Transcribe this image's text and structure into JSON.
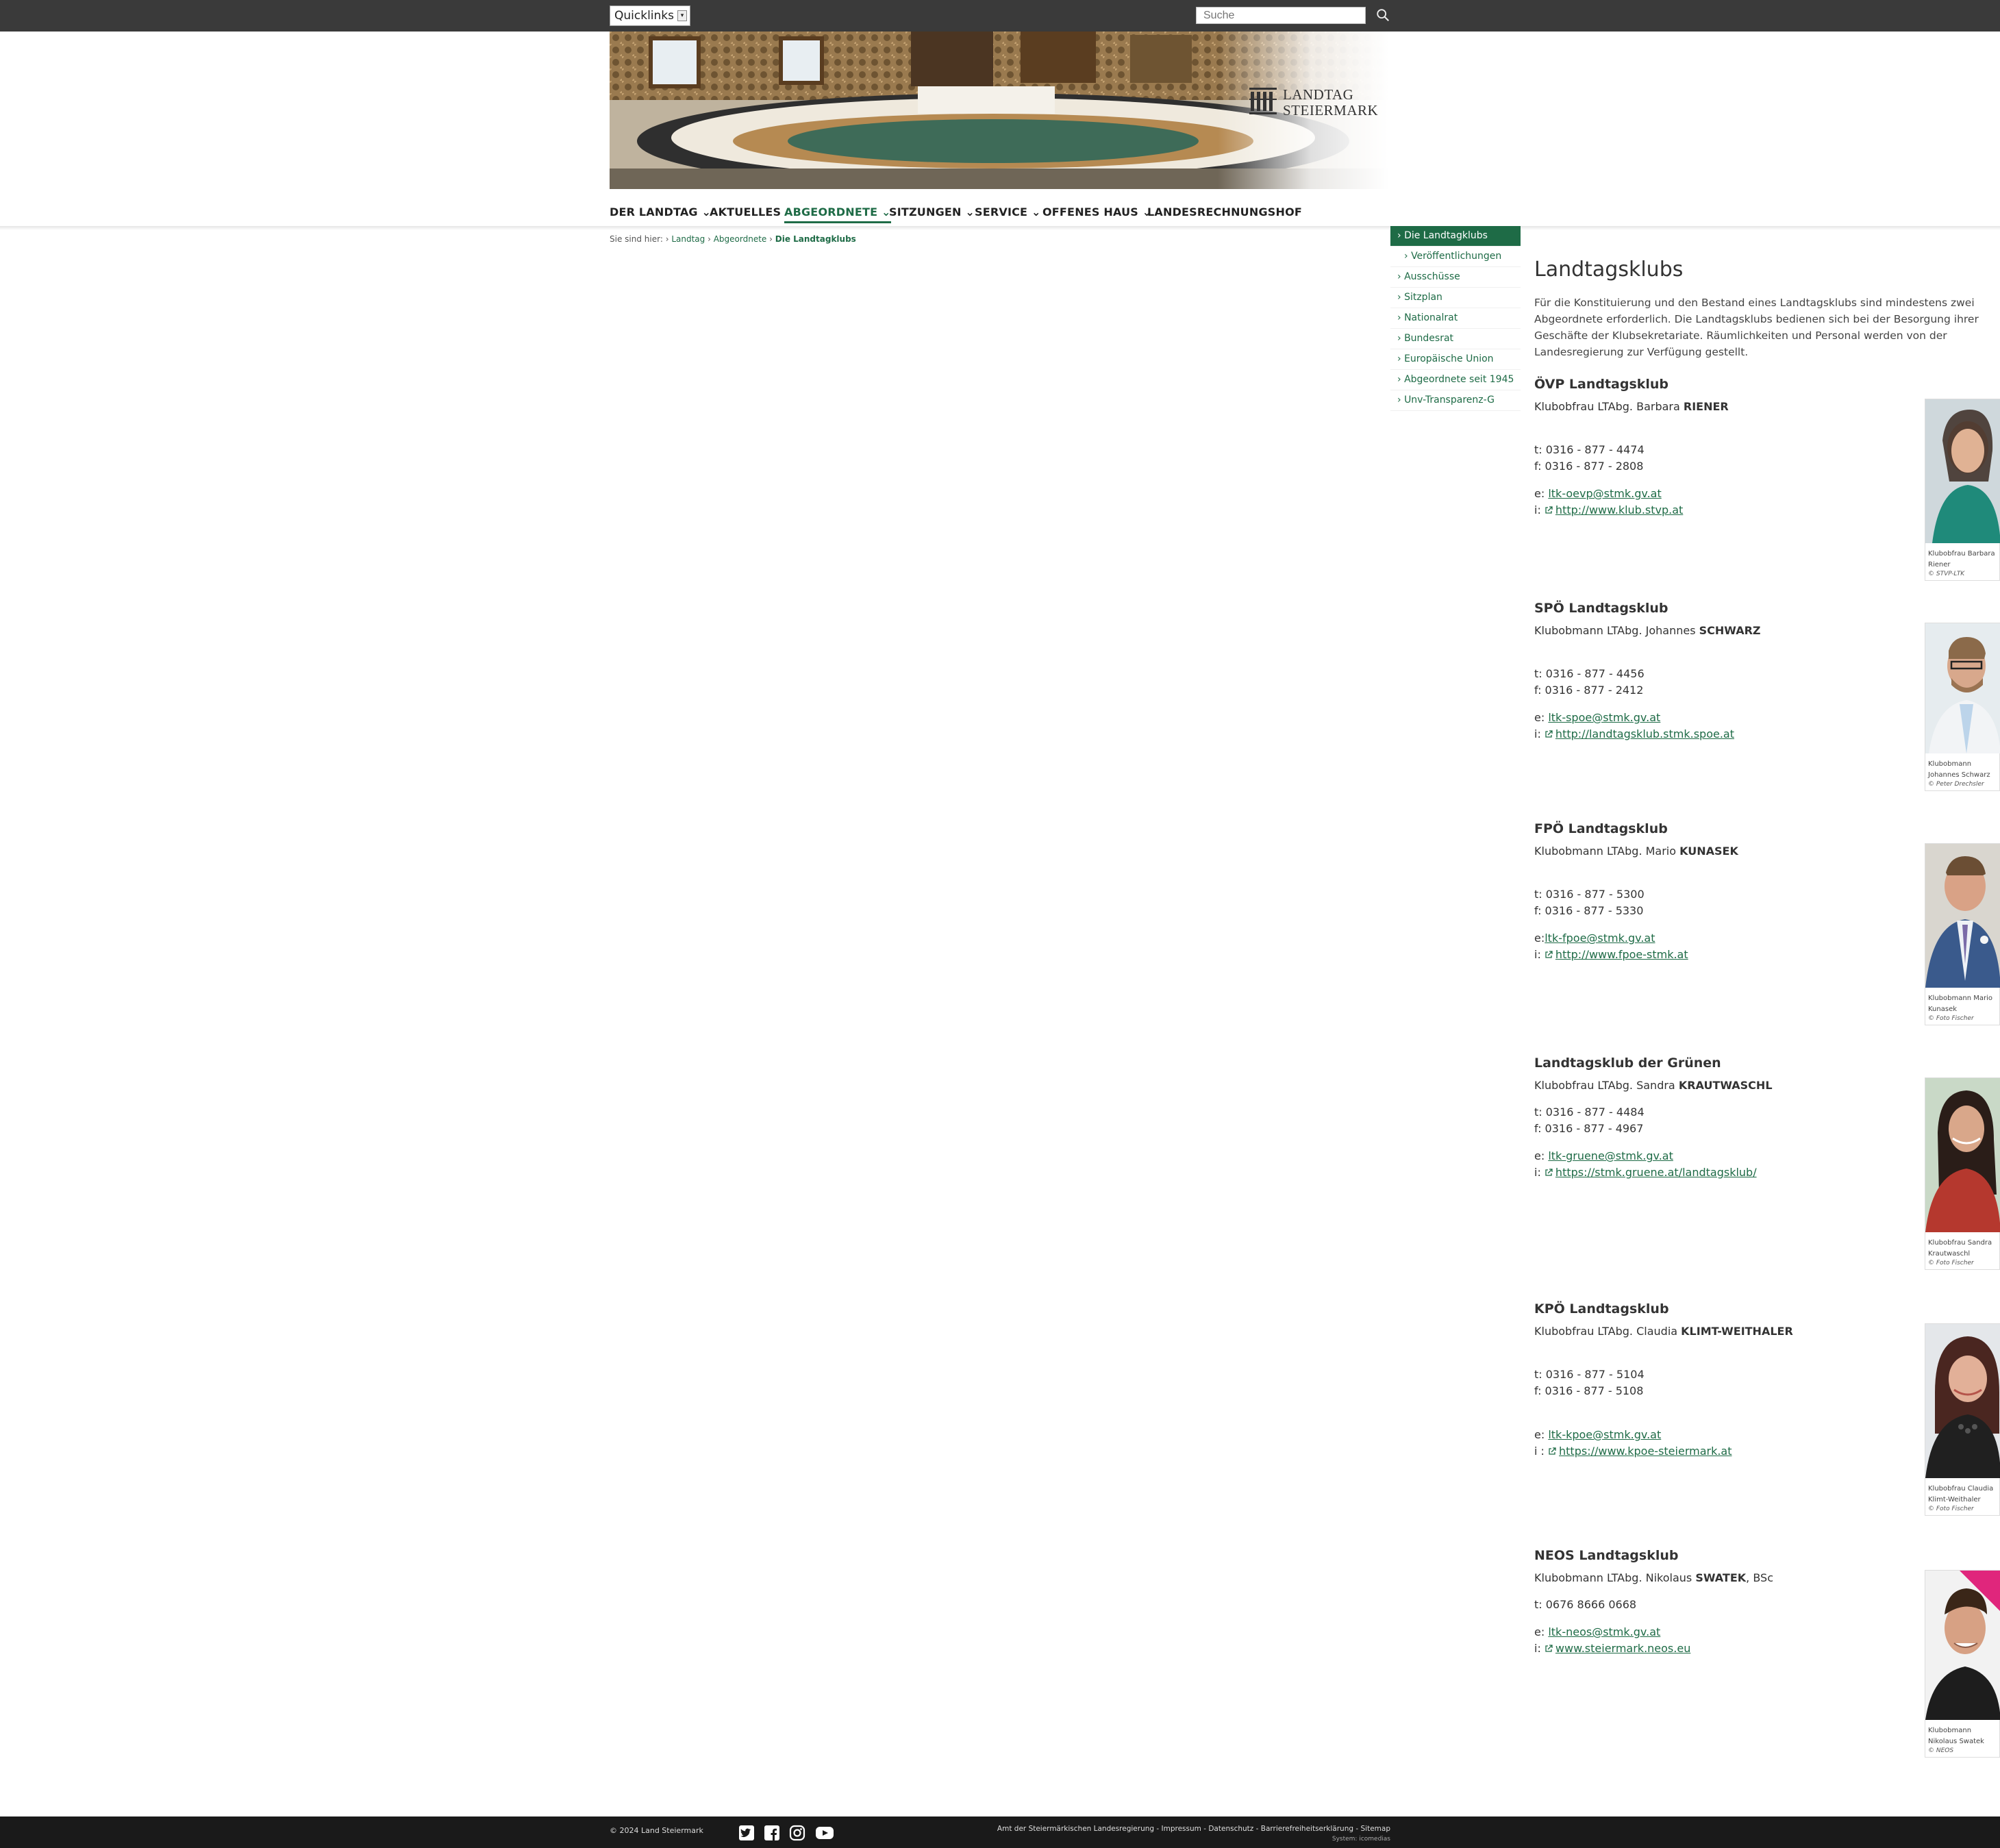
{
  "topbar": {
    "quicklinks_label": "Quicklinks",
    "search_placeholder": "Suche"
  },
  "logo": {
    "line1": "LANDTAG",
    "line2": "STEIERMARK"
  },
  "nav": {
    "items": [
      {
        "label": "DER LANDTAG",
        "has_dropdown": true
      },
      {
        "label": "AKTUELLES",
        "has_dropdown": false
      },
      {
        "label": "ABGEORDNETE",
        "has_dropdown": true,
        "active": true
      },
      {
        "label": "SITZUNGEN",
        "has_dropdown": true
      },
      {
        "label": "SERVICE",
        "has_dropdown": true
      },
      {
        "label": "OFFENES HAUS",
        "has_dropdown": true
      },
      {
        "label": "LANDESRECHNUNGSHOF",
        "has_dropdown": false
      }
    ]
  },
  "breadcrumb": {
    "prefix": "Sie sind hier:",
    "items": [
      "Landtag",
      "Abgeordnete",
      "Die Landtagklubs"
    ]
  },
  "sidebar": {
    "items": [
      {
        "label": "Die Landtagklubs",
        "active": true
      },
      {
        "label": "Veröffentlichungen",
        "sub": true
      },
      {
        "label": "Ausschüsse"
      },
      {
        "label": "Sitzplan"
      },
      {
        "label": "Nationalrat"
      },
      {
        "label": "Bundesrat"
      },
      {
        "label": "Europäische Union"
      },
      {
        "label": "Abgeordnete seit 1945"
      },
      {
        "label": "Unv-Transparenz-G"
      }
    ]
  },
  "main": {
    "title": "Landtagsklubs",
    "intro": "Für die Konstituierung und den Bestand eines Landtagsklubs sind mindestens zwei Abgeordnete erforderlich. Die Landtagsklubs bedienen sich bei der Besorgung ihrer Geschäfte der Klubsekretariate. Räumlichkeiten und Personal werden von der Landesregierung zur Verfügung gestellt."
  },
  "clubs": [
    {
      "name": "ÖVP Landtagsklub",
      "chair_prefix": "Klubobfrau LTAbg. Barbara ",
      "chair_last": "RIENER",
      "chair_suffix": "",
      "phone": "t: 0316 - 877 - 4474",
      "fax": "f: 0316 - 877 - 2808",
      "email_prefix": "e: ",
      "email": "ltk-oevp@stmk.gv.at",
      "web_prefix": "i: ",
      "web": "http://www.klub.stvp.at",
      "photo_caption": "Klubobfrau Barbara Riener",
      "photo_copyright": "© STVP-LTK"
    },
    {
      "name": "SPÖ Landtagsklub",
      "chair_prefix": "Klubobmann LTAbg. Johannes ",
      "chair_last": "SCHWARZ",
      "chair_suffix": "",
      "phone": "t: 0316 - 877 - 4456",
      "fax": "f: 0316 - 877 - 2412",
      "email_prefix": "e: ",
      "email": "ltk-spoe@stmk.gv.at",
      "web_prefix": "i: ",
      "web": "http://landtagsklub.stmk.spoe.at",
      "photo_caption": "Klubobmann Johannes Schwarz",
      "photo_copyright": "© Peter Drechsler"
    },
    {
      "name": "FPÖ Landtagsklub",
      "chair_prefix": "Klubobmann LTAbg. Mario ",
      "chair_last": "KUNASEK",
      "chair_suffix": "",
      "phone": "t: 0316 - 877 - 5300",
      "fax": "f: 0316 - 877 - 5330",
      "email_prefix": "e:",
      "email": "ltk-fpoe@stmk.gv.at",
      "web_prefix": "i: ",
      "web": "http://www.fpoe-stmk.at",
      "photo_caption": "Klubobmann Mario Kunasek",
      "photo_copyright": "© Foto Fischer"
    },
    {
      "name": "Landtagsklub der Grünen",
      "chair_prefix": "Klubobfrau LTAbg. Sandra ",
      "chair_last": "KRAUTWASCHL",
      "chair_suffix": "",
      "phone": "t: 0316 - 877 - 4484",
      "fax": "f: 0316 - 877 - 4967",
      "email_prefix": "e: ",
      "email": "ltk-gruene@stmk.gv.at",
      "web_prefix": "i: ",
      "web": "https://stmk.gruene.at/landtagsklub/",
      "photo_caption": "Klubobfrau Sandra Krautwaschl",
      "photo_copyright": "© Foto Fischer"
    },
    {
      "name": "KPÖ Landtagsklub",
      "chair_prefix": "Klubobfrau LTAbg. Claudia ",
      "chair_last": "KLIMT-WEITHALER",
      "chair_suffix": "",
      "phone": "t: 0316 - 877 - 5104",
      "fax": "f: 0316 - 877 - 5108",
      "email_prefix": "e: ",
      "email": "ltk-kpoe@stmk.gv.at",
      "web_prefix": "i : ",
      "web": "https://www.kpoe-steiermark.at",
      "photo_caption": "Klubobfrau Claudia Klimt-Weithaler",
      "photo_copyright": "© Foto Fischer"
    },
    {
      "name": "NEOS Landtagsklub",
      "chair_prefix": "Klubobmann LTAbg. Nikolaus ",
      "chair_last": "SWATEK",
      "chair_suffix": ", BSc",
      "phone": "t: 0676 8666 0668",
      "fax": "",
      "email_prefix": "e: ",
      "email": "ltk-neos@stmk.gv.at",
      "web_prefix": "i: ",
      "web": "www.steiermark.neos.eu",
      "photo_caption": "Klubobmann Nikolaus Swatek",
      "photo_copyright": "© NEOS"
    }
  ],
  "footer": {
    "copyright": "© 2024 Land Steiermark",
    "links": "Amt der Steiermärkischen Landesregierung - Impressum - Datenschutz - Barrierefreiheitserklärung - Sitemap",
    "system": "System: icomedias",
    "social": [
      "twitter-icon",
      "facebook-icon",
      "instagram-icon",
      "youtube-icon"
    ]
  },
  "colors": {
    "brand_green": "#1e6b46",
    "topbar": "#3a3a3a",
    "footer": "#1a1a1a"
  }
}
